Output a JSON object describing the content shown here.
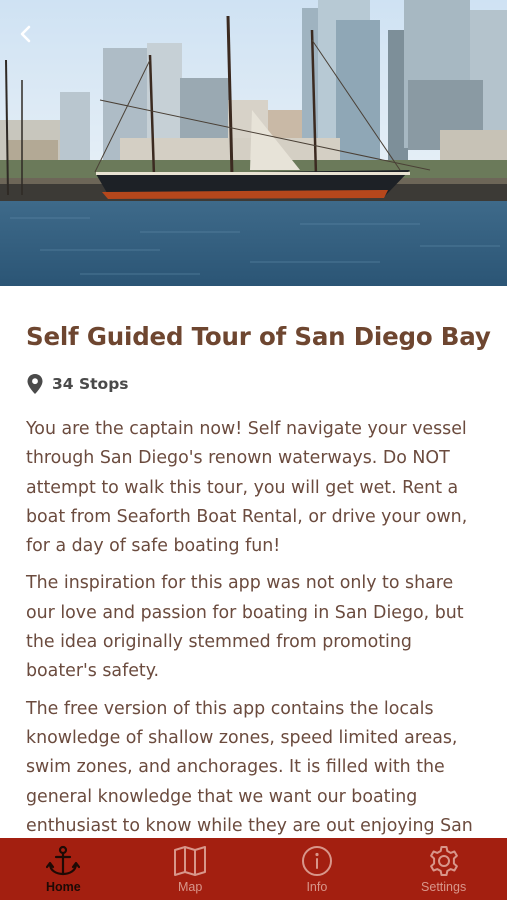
{
  "header": {
    "back_icon": "chevron-left-icon",
    "image": "tall ship docked in San Diego Bay in front of downtown skyline"
  },
  "tour": {
    "title": "Self Guided Tour of San Diego Bay",
    "stops_icon": "map-pin-icon",
    "stops_label": "34 Stops",
    "paragraphs": [
      "You are the captain now! Self navigate your vessel through San Diego's renown waterways. Do NOT attempt to walk this tour, you will get wet. Rent a boat from Seaforth Boat Rental, or drive your own, for a day of safe boating fun!",
      "The inspiration for this app was not only to share our love and passion for boating in San Diego, but the idea originally stemmed from promoting boater's safety.",
      "The free version of this app contains the locals knowledge of shallow zones, speed limited areas, swim zones, and anchorages. It is filled with the general knowledge that we want our boating enthusiast to know while they are out enjoying San"
    ]
  },
  "tabbar": {
    "tabs": [
      {
        "label": "Home",
        "icon": "anchor-icon",
        "active": true
      },
      {
        "label": "Map",
        "icon": "map-icon",
        "active": false
      },
      {
        "label": "Info",
        "icon": "info-icon",
        "active": false
      },
      {
        "label": "Settings",
        "icon": "gear-icon",
        "active": false
      }
    ]
  },
  "colors": {
    "title": "#6e4630",
    "body_text": "#6b4b3e",
    "tabbar_bg": "#a31f10",
    "tab_inactive": "#d8968a",
    "tab_active": "#1e0a05"
  }
}
